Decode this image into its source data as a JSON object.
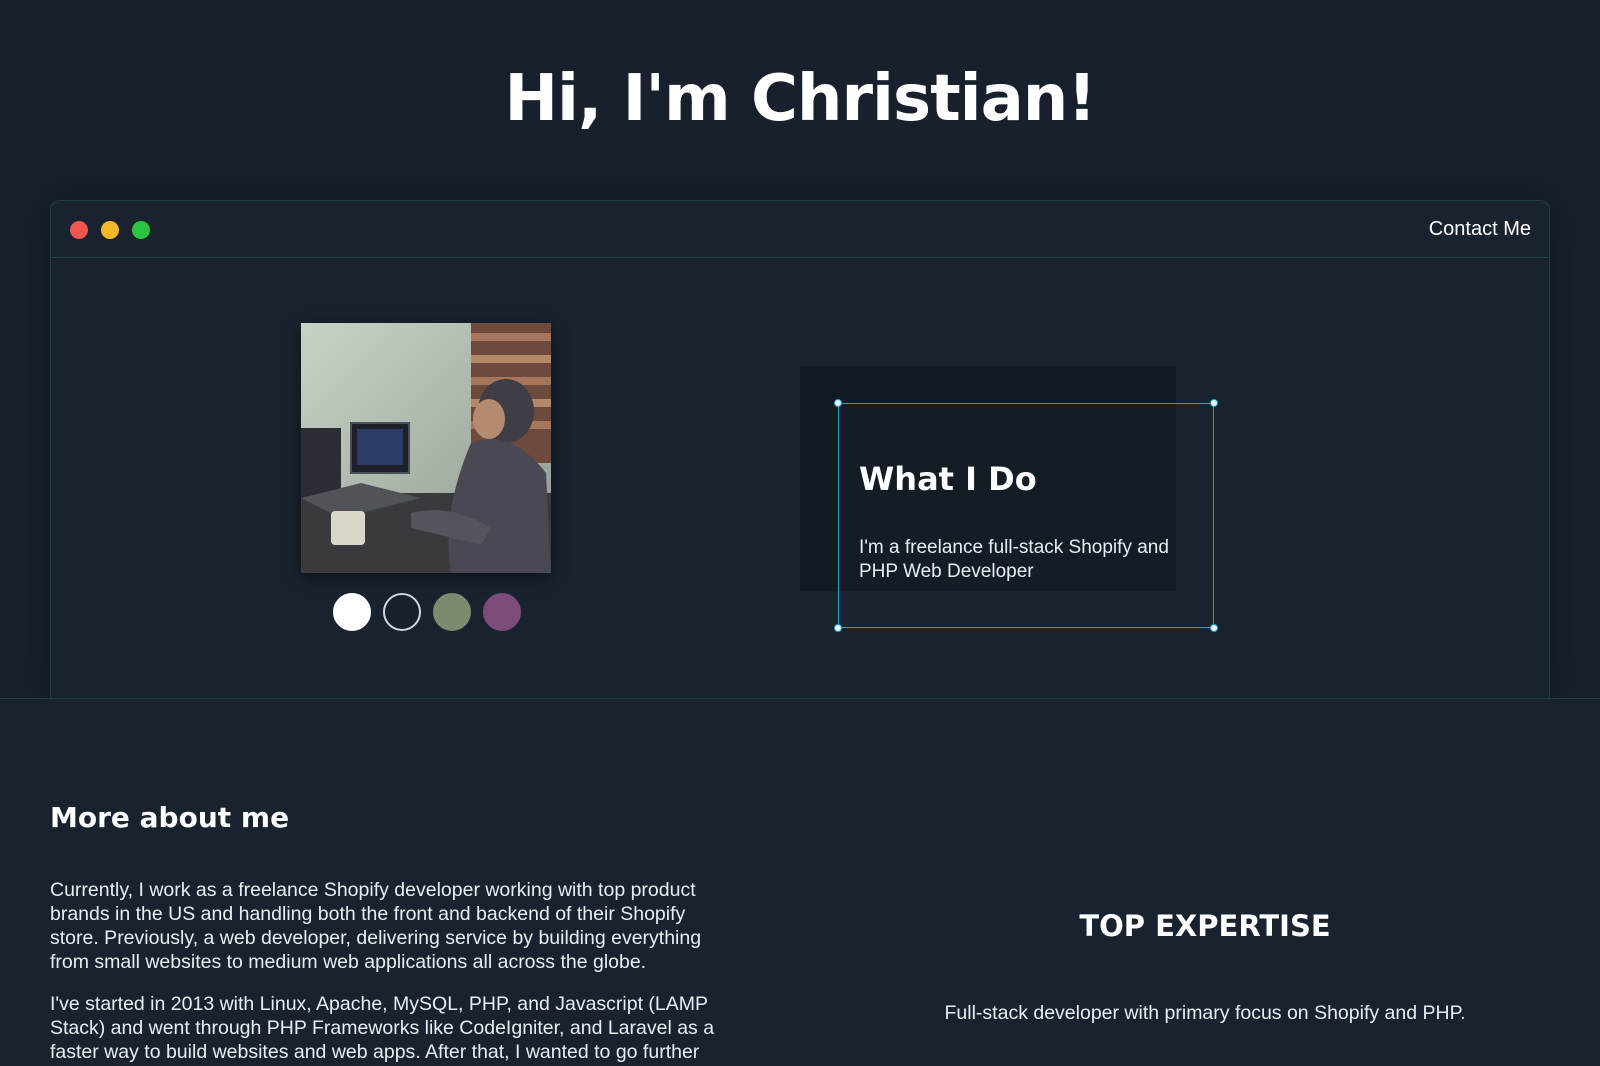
{
  "hero": {
    "title": "Hi, I'm Christian!"
  },
  "window": {
    "contact_label": "Contact Me",
    "traffic_lights": [
      "#f2564f",
      "#f5b62c",
      "#2ac540"
    ]
  },
  "profile": {
    "photo_alt": "Christian working at a desk with computers",
    "swatches": [
      "#ffffff",
      "#17202c",
      "#7c8b6c",
      "#7d4b78"
    ]
  },
  "what_i_do": {
    "title": "What I Do",
    "text": "I'm a freelance full-stack Shopify and PHP Web Developer"
  },
  "about": {
    "title": "More about me",
    "paragraph1": "Currently, I work as a freelance Shopify developer working with top product brands in the US and handling both the front and backend of their Shopify store. Previously, a web developer, delivering service by building everything from small websites to medium web applications all across the globe.",
    "paragraph2": "I've started in 2013 with Linux, Apache, MySQL, PHP, and Javascript (LAMP Stack) and went through PHP Frameworks like CodeIgniter, and Laravel as a faster way to build websites and web apps. After that, I wanted to go further"
  },
  "expertise": {
    "title": "TOP EXPERTISE",
    "text": "Full-stack developer with primary focus on Shopify and PHP."
  }
}
